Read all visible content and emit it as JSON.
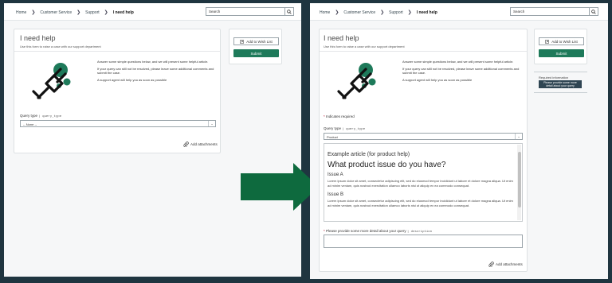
{
  "breadcrumb": [
    "Home",
    "Customer Service",
    "Support",
    "I need help"
  ],
  "search": {
    "placeholder": "Search"
  },
  "page": {
    "title": "I need help",
    "subtitle": "Use this form to raise a case with our support department",
    "intro": [
      "Answer some simple questions below, and we will present some helpful article.",
      "If your query can still not be resolved, please leave some additional comments and submit the case.",
      "A support agent will help you as soon as possible"
    ]
  },
  "form": {
    "required_note": "Indicates required",
    "query_type_label": "Query type",
    "query_type_var": "query_type",
    "query_type_value_before": "-- None --",
    "query_type_value_after": "Product",
    "detail_label": "Please provide some more detail about your query",
    "detail_var": "description",
    "add_attachments": "Add attachments"
  },
  "sidebar": {
    "wish_list": "Add to Wish List",
    "submit": "Submit",
    "required_info_title": "Required information",
    "required_info_badge": "Please provide some more detail about your query"
  },
  "article": {
    "heading": "Example article (for product help)",
    "title": "What product issue do you have?",
    "sections": [
      {
        "title": "Issue A",
        "body": "Lorem ipsum dolor sit amet, consectetur adipiscing elit, sed do eiusmod tempor incididunt ut labore et dolore magna aliqua. Ut enim ad minim veniam, quis nostrud exercitation ullamco laboris nisi ut aliquip ex ea commodo consequat."
      },
      {
        "title": "Issue B",
        "body": "Lorem ipsum dolor sit amet, consectetur adipiscing elit, sed do eiusmod tempor incididunt ut labore et dolore magna aliqua. Ut enim ad minim veniam, quis nostrud exercitation ullamco laboris nisi ut aliquip ex ea commodo consequat."
      }
    ]
  },
  "colors": {
    "accent": "#1e7a5a",
    "arrow": "#0e6a3e",
    "frame": "#1f3540"
  },
  "icons": [
    "search-icon",
    "chevron-right-icon",
    "wishlist-icon",
    "paperclip-icon",
    "chevron-down-icon",
    "plug-illustration"
  ]
}
